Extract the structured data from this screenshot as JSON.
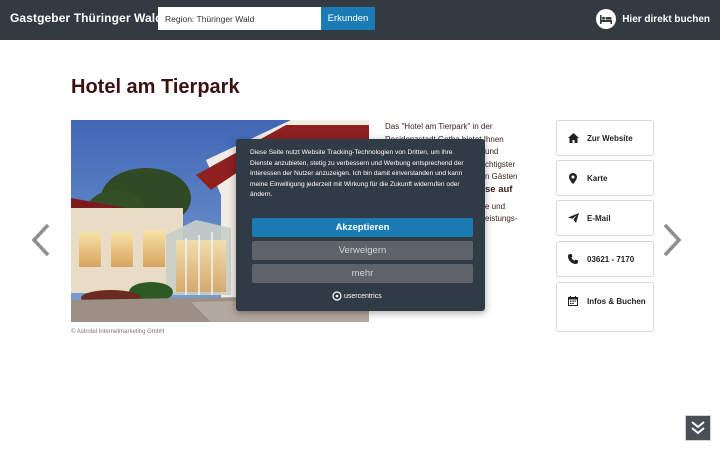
{
  "header": {
    "brand": "Gastgeber Thüringer Wald",
    "search_value": "Region: Thüringer Wald",
    "search_button": "Erkunden",
    "book_link": "Hier direkt buchen"
  },
  "page": {
    "title": "Hotel am Tierpark",
    "image_credit": "© Astrotel Internetmarketing GmbH"
  },
  "description": {
    "line1": "Das \"Hotel am Tierpark\" in der",
    "line2": "Residenzstadt Gotha bietet Ihnen",
    "line3": "und",
    "line4": "chtigster",
    "line5": "n Gästen",
    "line6_bold": "se auf",
    "line7": "e und",
    "line8": "eistungs-"
  },
  "side_buttons": [
    {
      "label": "Zur Website",
      "icon": "home-icon"
    },
    {
      "label": "Karte",
      "icon": "map-marker-icon"
    },
    {
      "label": "E-Mail",
      "icon": "paper-plane-icon"
    },
    {
      "label": "03621 - 7170",
      "icon": "phone-icon"
    },
    {
      "label": "Infos & Buchen",
      "icon": "calendar-icon"
    }
  ],
  "consent": {
    "text": "Diese Seite nutzt Website Tracking-Technologien von Dritten, um ihre Dienste anzubieten, stetig zu verbessern und Werbung entsprechend der Interessen der Nutzer anzuzeigen. Ich bin damit einverstanden und kann meine Einwilligung jederzeit mit Wirkung für die Zukunft widerrufen oder ändern.",
    "accept": "Akzeptieren",
    "deny": "Verweigern",
    "more": "mehr",
    "brand": "usercentrics"
  },
  "colors": {
    "header_bg": "#333a42",
    "accent_blue": "#1b7bb5",
    "title_color": "#3a1212",
    "dialog_bg": "#313b45"
  }
}
